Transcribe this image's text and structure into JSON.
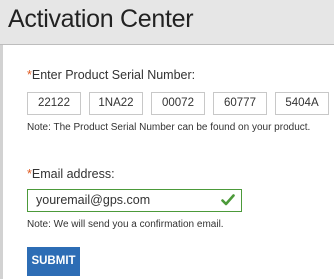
{
  "header": {
    "title": "Activation Center"
  },
  "serial": {
    "required_mark": "*",
    "label": "Enter Product Serial Number:",
    "segments": [
      "22122",
      "1NA22",
      "00072",
      "60777",
      "5404A"
    ],
    "note": "Note: The Product Serial Number can be found on your product."
  },
  "email": {
    "required_mark": "*",
    "label": "Email address:",
    "value": "youremail@gps.com",
    "note": "Note: We will send you a confirmation email.",
    "valid_icon": "checkmark-icon"
  },
  "submit": {
    "label": "SUBMIT"
  },
  "colors": {
    "required": "#e05a20",
    "valid_border": "#4c9a3a",
    "button": "#2d6db5",
    "header_bg": "#e6e6e6"
  }
}
